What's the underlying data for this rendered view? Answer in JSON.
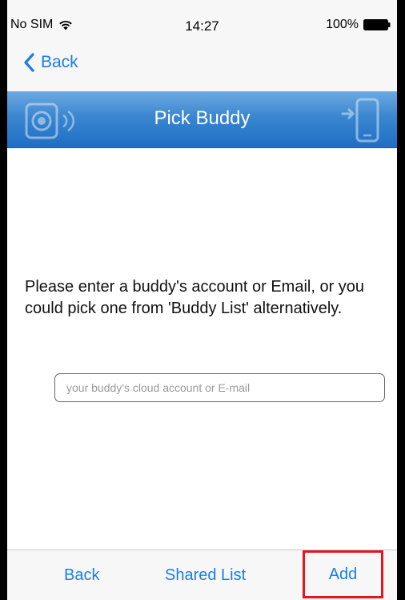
{
  "status_bar": {
    "carrier": "No SIM",
    "time": "14:27",
    "battery": "100%"
  },
  "nav": {
    "back_label": "Back"
  },
  "header": {
    "title": "Pick Buddy",
    "left_icon": "camera-icon",
    "right_icon": "phone-share-icon",
    "gradient_top": "#6da9e0",
    "gradient_bottom": "#1f6ec4"
  },
  "main": {
    "instructions": "Please enter a buddy's account or Email, or you could pick one from 'Buddy List' alternatively.",
    "account_input": {
      "value": "",
      "placeholder": "your buddy's cloud account or E-mail"
    }
  },
  "toolbar": {
    "back_label": "Back",
    "shared_list_label": "Shared List",
    "add_label": "Add",
    "highlight_color": "#e0171f"
  },
  "colors": {
    "accent": "#1a7ee8"
  }
}
